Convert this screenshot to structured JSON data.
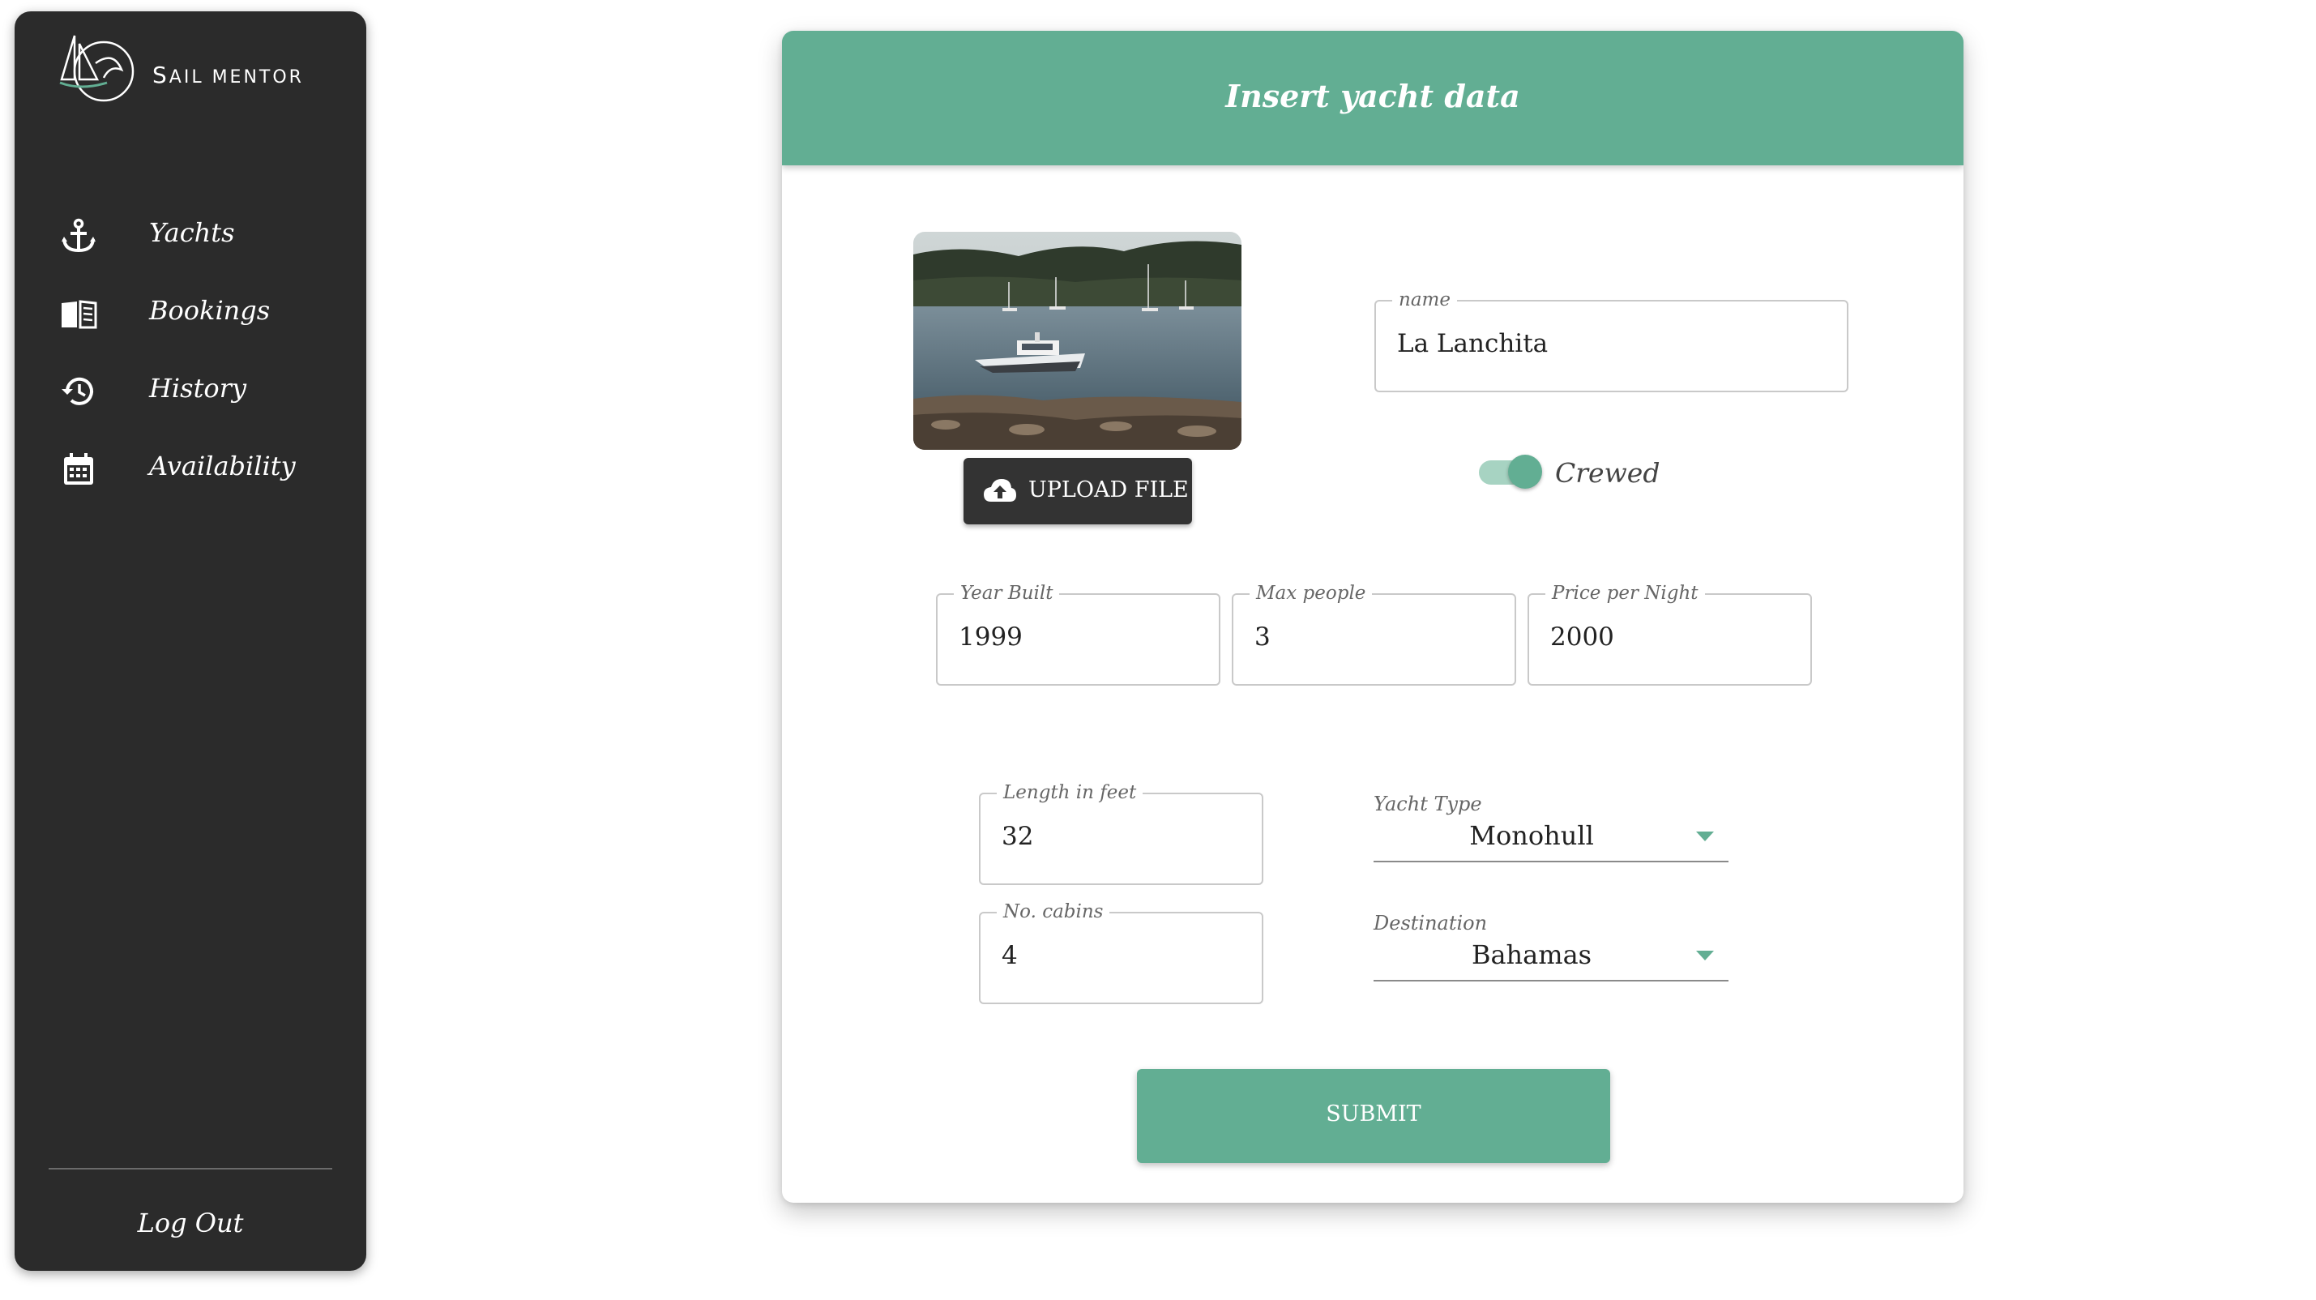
{
  "brand": {
    "name_initial": "S",
    "name_rest": "AIL MENTOR",
    "accent_color": "#62ae93"
  },
  "sidebar": {
    "items": [
      {
        "label": "Yachts",
        "icon": "anchor-icon"
      },
      {
        "label": "Bookings",
        "icon": "book-icon"
      },
      {
        "label": "History",
        "icon": "history-icon"
      },
      {
        "label": "Availability",
        "icon": "calendar-icon"
      }
    ],
    "logout_label": "Log Out",
    "background": "#2b2b2b"
  },
  "form": {
    "title": "Insert yacht data",
    "upload_label": "UPLOAD FILE",
    "name": {
      "label": "name",
      "value": "La Lanchita"
    },
    "crewed": {
      "label": "Crewed",
      "checked": true
    },
    "year_built": {
      "label": "Year Built",
      "value": "1999"
    },
    "max_people": {
      "label": "Max people",
      "value": "3"
    },
    "price_per_night": {
      "label": "Price per Night",
      "value": "2000"
    },
    "length": {
      "label": "Length in feet",
      "value": "32"
    },
    "cabins": {
      "label": "No. cabins",
      "value": "4"
    },
    "yacht_type": {
      "label": "Yacht Type",
      "value": "Monohull"
    },
    "destination": {
      "label": "Destination",
      "value": "Bahamas"
    },
    "submit_label": "SUBMIT"
  }
}
